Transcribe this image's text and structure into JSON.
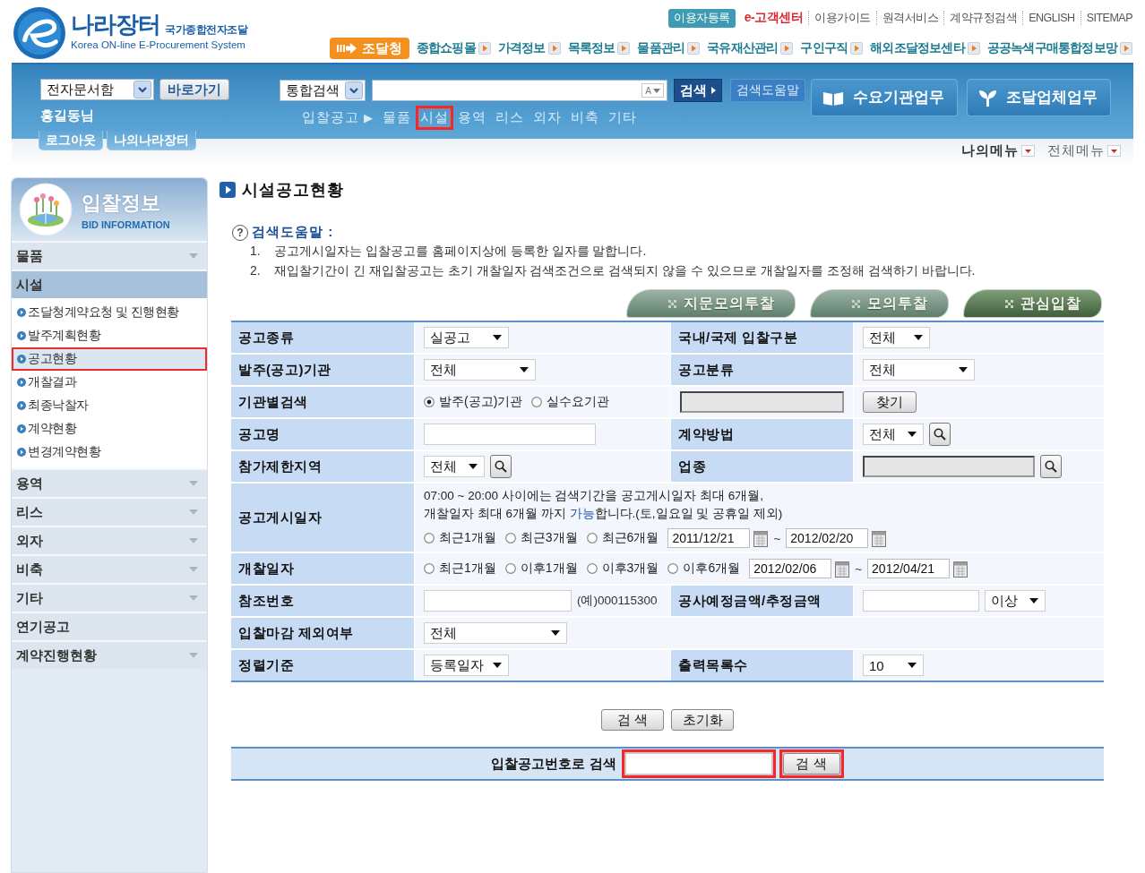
{
  "header": {
    "logo": {
      "title": "나라장터",
      "tagline": "국가종합전자조달",
      "english": "Korea ON-line E-Procurement System"
    },
    "top_links": [
      {
        "label": "이용자등록",
        "kind": "badge"
      },
      {
        "label": "e-고객센터",
        "kind": "accent"
      },
      {
        "label": "이용가이드",
        "kind": "plain"
      },
      {
        "label": "원격서비스",
        "kind": "plain"
      },
      {
        "label": "계약규정검색",
        "kind": "plain"
      },
      {
        "label": "ENGLISH",
        "kind": "plain"
      },
      {
        "label": "SITEMAP",
        "kind": "plain"
      }
    ],
    "home_button": "조달청",
    "nav": [
      "종합쇼핑몰",
      "가격정보",
      "목록정보",
      "물품관리",
      "국유재산관리",
      "구인구직",
      "해외조달정보센타",
      "공공녹색구매통합정보망"
    ]
  },
  "toolbar": {
    "document_select": "전자문서함",
    "go_button": "바로가기",
    "user": "홍길동님",
    "account_tabs": [
      "로그아웃",
      "나의나라장터"
    ],
    "scope_select": "통합검색",
    "input_mode": "A",
    "search_button": "검색",
    "help_button": "검색도움말",
    "bid_nav": {
      "label": "입찰공고",
      "separator": "▶",
      "items": [
        {
          "label": "물품",
          "highlighted": false
        },
        {
          "label": "시설",
          "highlighted": true
        },
        {
          "label": "용역",
          "highlighted": false
        },
        {
          "label": "리스",
          "highlighted": false
        },
        {
          "label": "외자",
          "highlighted": false
        },
        {
          "label": "비축",
          "highlighted": false
        },
        {
          "label": "기타",
          "highlighted": false
        }
      ]
    },
    "work_buttons": [
      {
        "label": "수요기관업무",
        "kind": "book"
      },
      {
        "label": "조달업체업무",
        "kind": "sprout"
      }
    ],
    "menus": [
      {
        "label": "나의메뉴",
        "selected": true
      },
      {
        "label": "전체메뉴",
        "selected": false
      }
    ]
  },
  "sidebar": {
    "title": "입찰정보",
    "subtitle": "BID INFORMATION",
    "items": [
      {
        "label": "물품",
        "kind": "folder",
        "expanded": false
      },
      {
        "label": "시설",
        "kind": "folder",
        "expanded": true,
        "children": [
          {
            "label": "조달청계약요청 및 진행현황",
            "selected": false,
            "highlighted": false
          },
          {
            "label": "발주계획현황",
            "selected": false,
            "highlighted": false
          },
          {
            "label": "공고현황",
            "selected": true,
            "highlighted": true
          },
          {
            "label": "개찰결과",
            "selected": false,
            "highlighted": false
          },
          {
            "label": "최종낙찰자",
            "selected": false,
            "highlighted": false
          },
          {
            "label": "계약현황",
            "selected": false,
            "highlighted": false
          },
          {
            "label": "변경계약현황",
            "selected": false,
            "highlighted": false
          }
        ]
      },
      {
        "label": "용역",
        "kind": "folder",
        "expanded": false
      },
      {
        "label": "리스",
        "kind": "folder",
        "expanded": false
      },
      {
        "label": "외자",
        "kind": "folder",
        "expanded": false
      },
      {
        "label": "비축",
        "kind": "folder",
        "expanded": false
      },
      {
        "label": "기타",
        "kind": "folder",
        "expanded": false
      },
      {
        "label": "연기공고",
        "kind": "link",
        "expanded": false
      },
      {
        "label": "계약진행현황",
        "kind": "folder",
        "expanded": false
      }
    ]
  },
  "page": {
    "title": "시설공고현황",
    "help": {
      "icon": "?",
      "title": "검색도움말 :",
      "items": [
        {
          "number": "1.",
          "text": "공고게시일자는 입찰공고를 홈페이지상에 등록한 일자를 말합니다."
        },
        {
          "number": "2.",
          "text": "재입찰기간이 긴 재입찰공고는 초기 개찰일자 검색조건으로 검색되지 않을 수 있으므로 개찰일자를 조정해 검색하기 바랍니다."
        }
      ]
    },
    "shortcut_tabs": [
      {
        "label": "지문모의투찰",
        "selected": false
      },
      {
        "label": "모의투찰",
        "selected": false
      },
      {
        "label": "관심입찰",
        "selected": true
      }
    ],
    "form": {
      "rows": [
        {
          "cells": [
            {
              "kind": "label",
              "text": "공고종류"
            },
            {
              "kind": "controls",
              "items": [
                {
                  "kind": "select",
                  "value": "실공고"
                }
              ]
            },
            {
              "kind": "label",
              "text": "국내/국제 입찰구분"
            },
            {
              "kind": "controls",
              "items": [
                {
                  "kind": "select",
                  "value": "전체"
                }
              ]
            }
          ]
        },
        {
          "cells": [
            {
              "kind": "label",
              "text": "발주(공고)기관"
            },
            {
              "kind": "controls",
              "items": [
                {
                  "kind": "select",
                  "value": "전체"
                }
              ]
            },
            {
              "kind": "label",
              "text": "공고분류"
            },
            {
              "kind": "controls",
              "items": [
                {
                  "kind": "select",
                  "value": "전체"
                }
              ]
            }
          ]
        },
        {
          "cells": [
            {
              "kind": "label",
              "text": "기관별검색"
            },
            {
              "kind": "controls",
              "items": [
                {
                  "kind": "radio",
                  "label": "발주(공고)기관",
                  "checked": true
                },
                {
                  "kind": "radio",
                  "label": "실수요기관",
                  "checked": false
                }
              ]
            },
            {
              "kind": "controls",
              "items": [
                {
                  "kind": "input",
                  "disabled": true
                }
              ]
            },
            {
              "kind": "controls",
              "items": [
                {
                  "kind": "button",
                  "label": "찾기"
                }
              ]
            }
          ]
        },
        {
          "cells": [
            {
              "kind": "label",
              "text": "공고명"
            },
            {
              "kind": "controls",
              "items": [
                {
                  "kind": "input",
                  "disabled": false
                }
              ]
            },
            {
              "kind": "label",
              "text": "계약방법"
            },
            {
              "kind": "controls",
              "items": [
                {
                  "kind": "select",
                  "value": "전체"
                },
                {
                  "kind": "lookup"
                }
              ]
            }
          ]
        },
        {
          "cells": [
            {
              "kind": "label",
              "text": "참가제한지역"
            },
            {
              "kind": "controls",
              "items": [
                {
                  "kind": "select",
                  "value": "전체"
                },
                {
                  "kind": "lookup"
                }
              ]
            },
            {
              "kind": "label",
              "text": "업종"
            },
            {
              "kind": "controls",
              "items": [
                {
                  "kind": "input",
                  "disabled": true
                },
                {
                  "kind": "lookup"
                }
              ]
            }
          ]
        },
        {
          "cells": [
            {
              "kind": "label",
              "text": "공고게시일자"
            },
            {
              "kind": "controls",
              "items": [
                {
                  "kind": "note",
                  "lines": [
                    [
                      {
                        "kind": "text",
                        "text": "07:00 ~ 20:00 사이에는 검색기간을 공고게시일자 최대 6개월,"
                      }
                    ],
                    [
                      {
                        "kind": "text",
                        "text": "개찰일자 최대 6개월 까지 "
                      },
                      {
                        "kind": "link",
                        "text": "가능"
                      },
                      {
                        "kind": "text",
                        "text": "합니다.(토,일요일 및 공휴일 제외)"
                      }
                    ]
                  ]
                },
                {
                  "kind": "radio",
                  "label": "최근1개월",
                  "checked": false
                },
                {
                  "kind": "radio",
                  "label": "최근3개월",
                  "checked": false
                },
                {
                  "kind": "radio",
                  "label": "최근6개월",
                  "checked": false
                },
                {
                  "kind": "date",
                  "value": "2011/12/21"
                },
                {
                  "kind": "text",
                  "text": "~"
                },
                {
                  "kind": "date",
                  "value": "2012/02/20"
                }
              ]
            }
          ]
        },
        {
          "cells": [
            {
              "kind": "label",
              "text": "개찰일자"
            },
            {
              "kind": "controls",
              "items": [
                {
                  "kind": "radio",
                  "label": "최근1개월",
                  "checked": false
                },
                {
                  "kind": "radio",
                  "label": "이후1개월",
                  "checked": false
                },
                {
                  "kind": "radio",
                  "label": "이후3개월",
                  "checked": false
                },
                {
                  "kind": "radio",
                  "label": "이후6개월",
                  "checked": false
                },
                {
                  "kind": "date",
                  "value": "2012/02/06"
                },
                {
                  "kind": "text",
                  "text": "~"
                },
                {
                  "kind": "date",
                  "value": "2012/04/21"
                }
              ]
            }
          ]
        },
        {
          "cells": [
            {
              "kind": "label",
              "text": "참조번호"
            },
            {
              "kind": "controls",
              "items": [
                {
                  "kind": "input",
                  "disabled": false
                },
                {
                  "kind": "text",
                  "text": "(예)000115300"
                }
              ]
            },
            {
              "kind": "label",
              "text": "공사예정금액/추정금액"
            },
            {
              "kind": "controls",
              "items": [
                {
                  "kind": "input",
                  "disabled": false
                },
                {
                  "kind": "select",
                  "value": "이상"
                }
              ]
            }
          ]
        },
        {
          "cells": [
            {
              "kind": "label",
              "text": "입찰마감 제외여부"
            },
            {
              "kind": "controls",
              "items": [
                {
                  "kind": "select",
                  "value": "전체"
                }
              ]
            }
          ]
        },
        {
          "cells": [
            {
              "kind": "label",
              "text": "정렬기준"
            },
            {
              "kind": "controls",
              "items": [
                {
                  "kind": "select",
                  "value": "등록일자"
                }
              ]
            },
            {
              "kind": "label",
              "text": "출력목록수"
            },
            {
              "kind": "controls",
              "items": [
                {
                  "kind": "select",
                  "value": "10"
                }
              ]
            }
          ]
        }
      ]
    },
    "actions": [
      "검 색",
      "초기화"
    ],
    "bid_number_search": {
      "label": "입찰공고번호로 검색",
      "input": {
        "highlighted": true
      },
      "button": {
        "label": "검 색",
        "highlighted": true
      }
    }
  }
}
